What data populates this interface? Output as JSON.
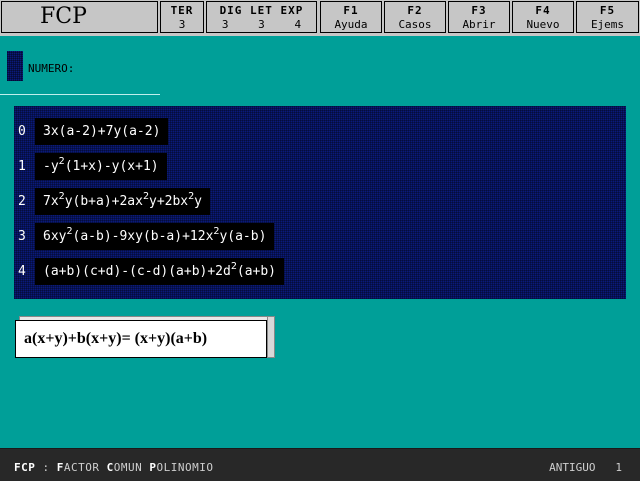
{
  "app_title": "FCP",
  "counters": [
    {
      "label": "TER",
      "values": [
        "3"
      ]
    },
    {
      "label": "DIG LET EXP",
      "values": [
        "3",
        "3",
        "4"
      ]
    }
  ],
  "fkeys": [
    {
      "key": "F1",
      "label": "Ayuda"
    },
    {
      "key": "F2",
      "label": "Casos"
    },
    {
      "key": "F3",
      "label": "Abrir"
    },
    {
      "key": "F4",
      "label": "Nuevo"
    },
    {
      "key": "F5",
      "label": "Ejems"
    }
  ],
  "numero_label": "NUMERO:",
  "cases": [
    {
      "index": "0",
      "parts": [
        [
          "t",
          "3x(a-2)+7y(a-2)"
        ]
      ]
    },
    {
      "index": "1",
      "parts": [
        [
          "t",
          "-y"
        ],
        [
          "s",
          "2"
        ],
        [
          "t",
          "(1+x)-y(x+1)"
        ]
      ]
    },
    {
      "index": "2",
      "parts": [
        [
          "t",
          "7x"
        ],
        [
          "s",
          "2"
        ],
        [
          "t",
          "y(b+a)+2ax"
        ],
        [
          "s",
          "2"
        ],
        [
          "t",
          "y+2bx"
        ],
        [
          "s",
          "2"
        ],
        [
          "t",
          "y"
        ]
      ]
    },
    {
      "index": "3",
      "parts": [
        [
          "t",
          "6xy"
        ],
        [
          "s",
          "2"
        ],
        [
          "t",
          "(a-b)-9xy(b-a)+12x"
        ],
        [
          "s",
          "2"
        ],
        [
          "t",
          "y(a-b)"
        ]
      ]
    },
    {
      "index": "4",
      "parts": [
        [
          "t",
          "(a+b)(c+d)-(c-d)(a+b)+2d"
        ],
        [
          "s",
          "2"
        ],
        [
          "t",
          "(a+b)"
        ]
      ]
    }
  ],
  "example": "a(x+y)+b(x+y)=  (x+y)(a+b)",
  "status": {
    "left_parts": [
      [
        "h",
        "FCP"
      ],
      [
        "t",
        " : "
      ],
      [
        "h",
        "F"
      ],
      [
        "t",
        "ACTOR "
      ],
      [
        "h",
        "C"
      ],
      [
        "t",
        "OMUN "
      ],
      [
        "h",
        "P"
      ],
      [
        "t",
        "OLINOMIO"
      ]
    ],
    "right_label": "ANTIGUO",
    "right_value": "1"
  }
}
